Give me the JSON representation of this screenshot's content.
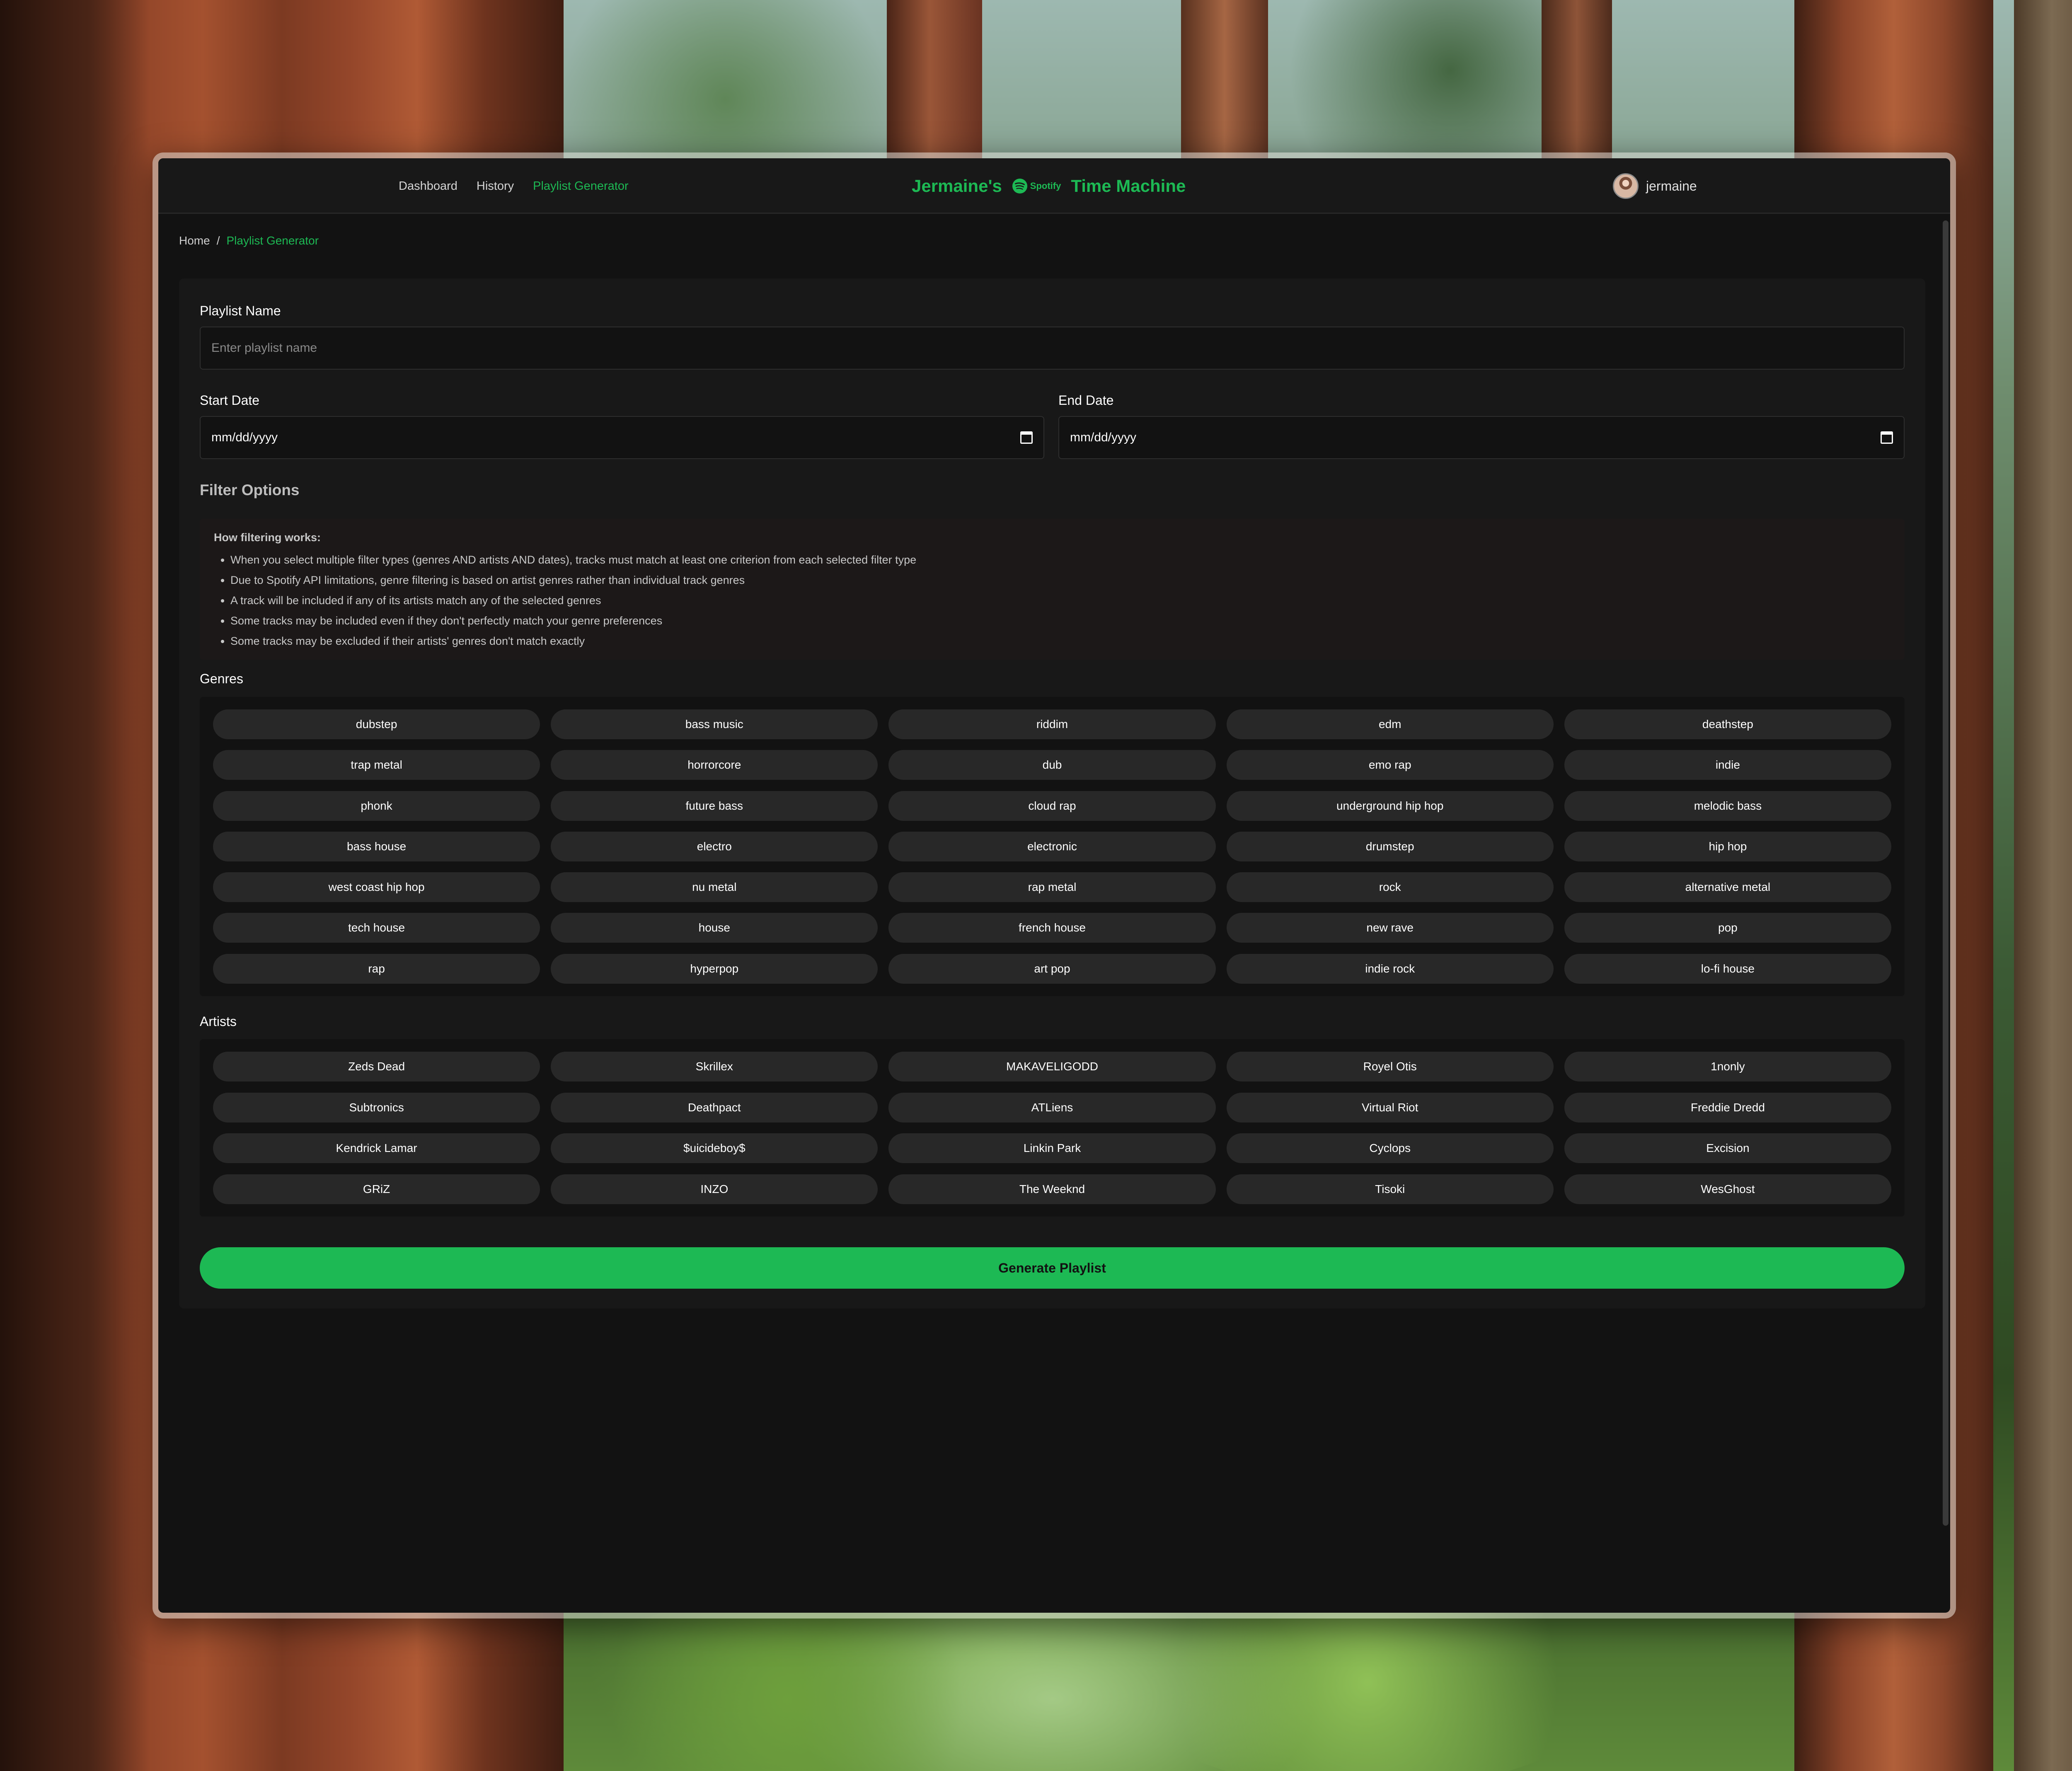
{
  "nav": {
    "links": [
      "Dashboard",
      "History",
      "Playlist Generator"
    ],
    "brand_prefix": "Jermaine's",
    "brand_logo_text": "Spotify",
    "brand_suffix": "Time Machine",
    "username": "jermaine"
  },
  "breadcrumb": {
    "home": "Home",
    "separator": "/",
    "current": "Playlist Generator"
  },
  "form": {
    "playlist_name_label": "Playlist Name",
    "playlist_name_placeholder": "Enter playlist name",
    "start_date_label": "Start Date",
    "start_date_value": "mm/dd/yyyy",
    "end_date_label": "End Date",
    "end_date_value": "mm/dd/yyyy"
  },
  "filter": {
    "title": "Filter Options",
    "info_title": "How filtering works:",
    "info_items": [
      "When you select multiple filter types (genres AND artists AND dates), tracks must match at least one criterion from each selected filter type",
      "Due to Spotify API limitations, genre filtering is based on artist genres rather than individual track genres",
      "A track will be included if any of its artists match any of the selected genres",
      "Some tracks may be included even if they don't perfectly match your genre preferences",
      "Some tracks may be excluded if their artists' genres don't match exactly"
    ]
  },
  "genres": {
    "label": "Genres",
    "items": [
      "dubstep",
      "bass music",
      "riddim",
      "edm",
      "deathstep",
      "trap metal",
      "horrorcore",
      "dub",
      "emo rap",
      "indie",
      "phonk",
      "future bass",
      "cloud rap",
      "underground hip hop",
      "melodic bass",
      "bass house",
      "electro",
      "electronic",
      "drumstep",
      "hip hop",
      "west coast hip hop",
      "nu metal",
      "rap metal",
      "rock",
      "alternative metal",
      "tech house",
      "house",
      "french house",
      "new rave",
      "pop",
      "rap",
      "hyperpop",
      "art pop",
      "indie rock",
      "lo-fi house"
    ]
  },
  "artists": {
    "label": "Artists",
    "items": [
      "Zeds Dead",
      "Skrillex",
      "MAKAVELIGODD",
      "Royel Otis",
      "1nonly",
      "Subtronics",
      "Deathpact",
      "ATLiens",
      "Virtual Riot",
      "Freddie Dredd",
      "Kendrick Lamar",
      "$uicideboy$",
      "Linkin Park",
      "Cyclops",
      "Excision",
      "GRiZ",
      "INZO",
      "The Weeknd",
      "Tisoki",
      "WesGhost"
    ]
  },
  "generate_button": "Generate Playlist",
  "colors": {
    "accent": "#1db954",
    "background": "#121212",
    "surface": "#181818",
    "chip": "#282828"
  }
}
